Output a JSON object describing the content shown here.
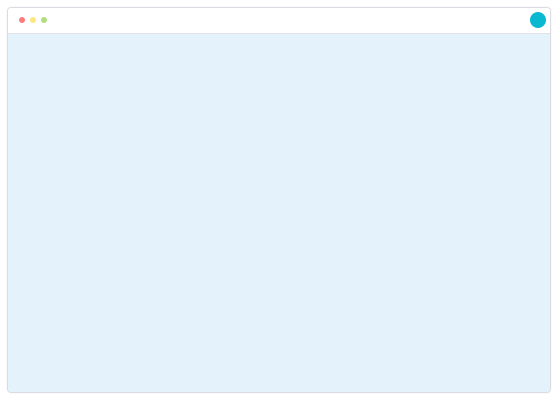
{
  "window": {
    "titlebar": {
      "traffic_lights": [
        {
          "name": "close",
          "color": "#ff7b7b"
        },
        {
          "name": "minimize",
          "color": "#fbe87e"
        },
        {
          "name": "zoom",
          "color": "#b2dd7f"
        }
      ],
      "avatar": {
        "icon": "avatar-circle-icon",
        "color": "#0ab8d0"
      }
    },
    "content": {
      "background": "#e4f3fb"
    }
  }
}
